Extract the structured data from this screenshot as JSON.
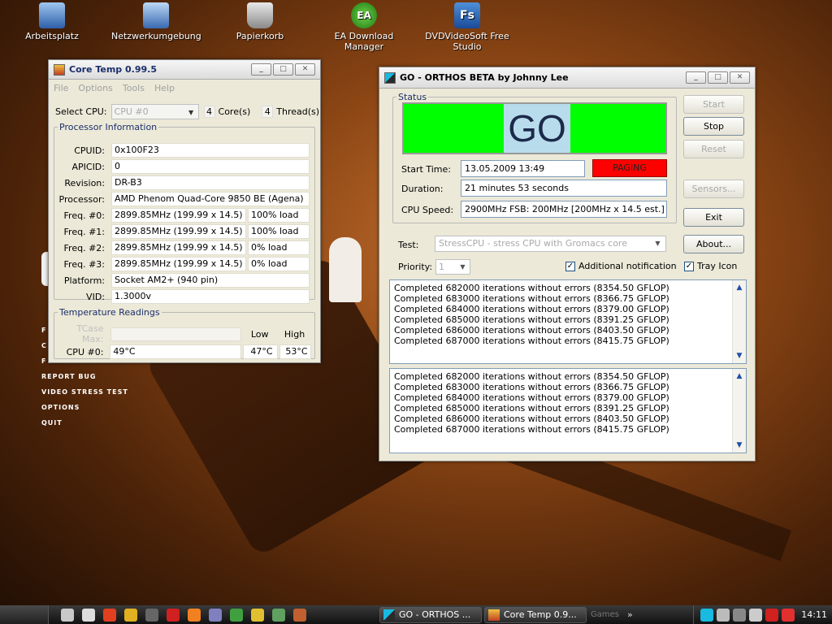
{
  "desktop": {
    "icons": [
      "Arbeitsplatz",
      "Netzwerkumgebung",
      "Papierkorb",
      "EA Download Manager",
      "DVDVideoSoft Free Studio"
    ],
    "game_menu": [
      "F",
      "C",
      "F",
      "REPORT BUG",
      "VIDEO STRESS TEST",
      "OPTIONS",
      "QUIT"
    ]
  },
  "coretemp": {
    "title": "Core Temp 0.99.5",
    "menu": [
      "File",
      "Options",
      "Tools",
      "Help"
    ],
    "select_cpu_label": "Select CPU:",
    "select_cpu_value": "CPU #0",
    "cores_count": "4",
    "cores_label": "Core(s)",
    "threads_count": "4",
    "threads_label": "Thread(s)",
    "proc_legend": "Processor Information",
    "rows": [
      {
        "label": "CPUID:",
        "value": "0x100F23"
      },
      {
        "label": "APICID:",
        "value": "0"
      },
      {
        "label": "Revision:",
        "value": "DR-B3"
      },
      {
        "label": "Processor:",
        "value": "AMD Phenom Quad-Core 9850 BE (Agena)"
      },
      {
        "label": "Freq. #0:",
        "value": "2899.85MHz (199.99 x 14.5)",
        "load": "100% load"
      },
      {
        "label": "Freq. #1:",
        "value": "2899.85MHz (199.99 x 14.5)",
        "load": "100% load"
      },
      {
        "label": "Freq. #2:",
        "value": "2899.85MHz (199.99 x 14.5)",
        "load": "0% load"
      },
      {
        "label": "Freq. #3:",
        "value": "2899.85MHz (199.99 x 14.5)",
        "load": "0% load"
      },
      {
        "label": "Platform:",
        "value": "Socket AM2+ (940 pin)"
      },
      {
        "label": "VID:",
        "value": "1.3000v"
      }
    ],
    "temp_legend": "Temperature Readings",
    "tcase_label": "TCase Max:",
    "low_label": "Low",
    "high_label": "High",
    "cpu0_label": "CPU #0:",
    "cpu0_temp": "49°C",
    "cpu0_low": "47°C",
    "cpu0_high": "53°C"
  },
  "orthos": {
    "title": "GO - ORTHOS BETA by Johnny Lee",
    "status_legend": "Status",
    "go_text": "GO",
    "start_time_label": "Start Time:",
    "start_time": "13.05.2009 13:49",
    "paging": "PAGING",
    "duration_label": "Duration:",
    "duration": "21 minutes 53 seconds",
    "cpu_speed_label": "CPU Speed:",
    "cpu_speed": "2900MHz FSB: 200MHz [200MHz x 14.5 est.]",
    "buttons": {
      "start": "Start",
      "stop": "Stop",
      "reset": "Reset",
      "sensors": "Sensors...",
      "exit": "Exit",
      "about": "About..."
    },
    "test_label": "Test:",
    "test_value": "StressCPU - stress CPU with Gromacs core",
    "priority_label": "Priority:",
    "priority_value": "1",
    "additional_notification": "Additional notification",
    "tray_icon": "Tray Icon",
    "log1": [
      "Completed 682000 iterations without errors (8354.50 GFLOP)",
      "Completed 683000 iterations without errors (8366.75 GFLOP)",
      "Completed 684000 iterations without errors (8379.00 GFLOP)",
      "Completed 685000 iterations without errors (8391.25 GFLOP)",
      "Completed 686000 iterations without errors (8403.50 GFLOP)",
      "Completed 687000 iterations without errors (8415.75 GFLOP)"
    ],
    "log2": [
      "Completed 682000 iterations without errors (8354.50 GFLOP)",
      "Completed 683000 iterations without errors (8366.75 GFLOP)",
      "Completed 684000 iterations without errors (8379.00 GFLOP)",
      "Completed 685000 iterations without errors (8391.25 GFLOP)",
      "Completed 686000 iterations without errors (8403.50 GFLOP)",
      "Completed 687000 iterations without errors (8415.75 GFLOP)"
    ]
  },
  "taskbar": {
    "tasks": [
      "GO - ORTHOS ...",
      "Core Temp 0.9..."
    ],
    "games": "Games",
    "clock": "14:11"
  },
  "colors": {
    "go_green": "#00ff00",
    "go_box": "#b8dcec",
    "paging_red": "#ff0000"
  }
}
